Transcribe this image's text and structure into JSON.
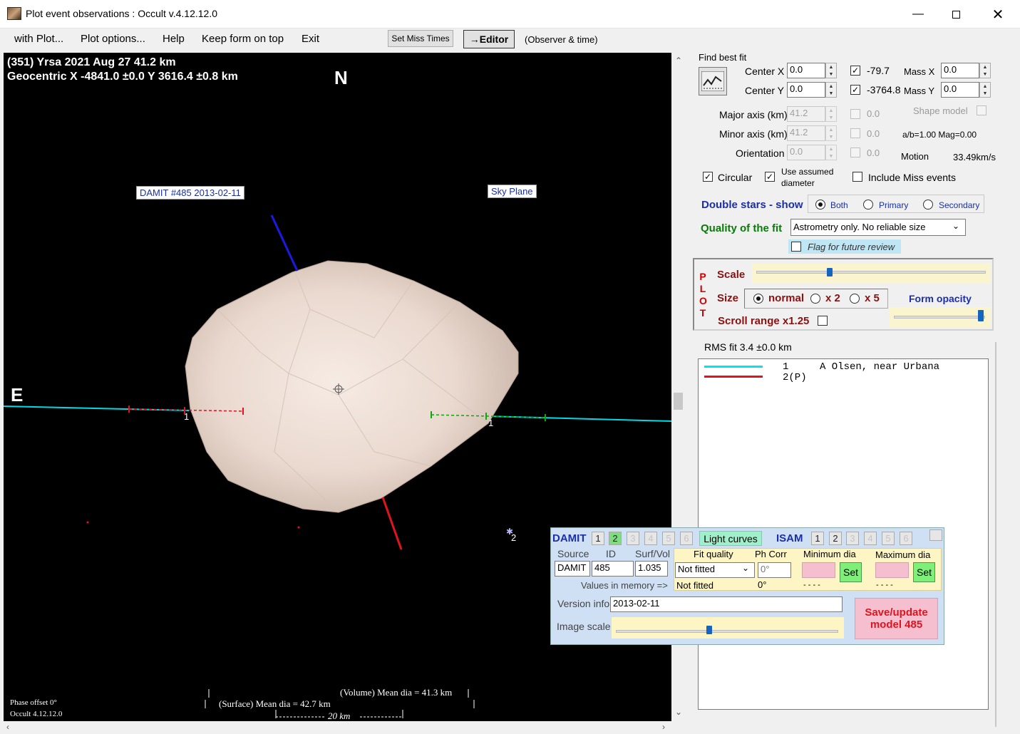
{
  "window": {
    "title": "Plot event observations : Occult v.4.12.12.0"
  },
  "menu": {
    "items": [
      "with Plot...",
      "Plot options...",
      "Help",
      "Keep form on top",
      "Exit"
    ],
    "set_miss_times": "Set Miss Times",
    "editor": "→Editor",
    "observer_time": "(Observer & time)"
  },
  "plot": {
    "header_line1": "(351) Yrsa  2021 Aug 27   41.2 km",
    "header_line2": "Geocentric  X  -4841.0 ±0.0  Y 3616.4 ±0.8 km",
    "north": "N",
    "east": "E",
    "damit_label": "DAMIT #485 2013-02-11",
    "sky_plane_label": "Sky Plane",
    "chord_label_1a": "1",
    "chord_label_1b": "1",
    "miss_label": "2",
    "volume_mean": "(Volume) Mean dia = 41.3 km",
    "surface_mean": "(Surface) Mean dia = 42.7 km",
    "scale_km": "20 km",
    "phase_offset": "Phase offset 0°",
    "version": "Occult 4.12.12.0"
  },
  "fit": {
    "find_best_fit": "Find best fit",
    "center_x_label": "Center X",
    "center_x": "0.0",
    "center_y_label": "Center Y",
    "center_y": "0.0",
    "center_x_value": "-79.7",
    "center_y_value": "-3764.8",
    "mass_x_label": "Mass X",
    "mass_x": "0.0",
    "mass_y_label": "Mass Y",
    "mass_y": "0.0",
    "major_label": "Major axis (km)",
    "major": "41.2",
    "major_chk": "0.0",
    "minor_label": "Minor axis (km)",
    "minor": "41.2",
    "minor_chk": "0.0",
    "orientation_label": "Orientation",
    "orientation": "0.0",
    "orientation_chk": "0.0",
    "shape_model": "Shape model",
    "ab_mag": "a/b=1.00  Mag=0.00",
    "motion_label": "Motion",
    "motion_value": "33.49km/s",
    "circular": "Circular",
    "use_assumed_1": "Use assumed",
    "use_assumed_2": "diameter",
    "include_miss": "Include Miss events"
  },
  "double_stars": {
    "label": "Double stars - show",
    "options": [
      "Both",
      "Primary",
      "Secondary"
    ],
    "selected": "Both"
  },
  "quality": {
    "label": "Quality of the fit",
    "value": "Astrometry only. No reliable size",
    "flag": "Flag for future review"
  },
  "plot_ctrl": {
    "letters": [
      "P",
      "L",
      "O",
      "T"
    ],
    "scale": "Scale",
    "size": "Size",
    "size_options": [
      "normal",
      "x 2",
      "x 5"
    ],
    "size_selected": "normal",
    "form_opacity": "Form opacity",
    "scroll_range": "Scroll range x1.25",
    "scale_level": 0.32,
    "opacity_level": 0.95
  },
  "rms": {
    "text": "RMS fit 3.4 ±0.0 km"
  },
  "legend": {
    "rows": [
      {
        "num": "1",
        "name": "A Olsen, near Urbana",
        "color": "#00e5ee"
      },
      {
        "num": "2(P)",
        "name": "",
        "color": "#e0141e"
      }
    ]
  },
  "damit": {
    "damit_label": "DAMIT",
    "damit_nums": [
      "1",
      "2",
      "3",
      "4",
      "5",
      "6"
    ],
    "damit_active": "2",
    "light_curves": "Light curves",
    "isam_label": "ISAM",
    "isam_nums": [
      "1",
      "2",
      "3",
      "4",
      "5",
      "6"
    ],
    "source_hdr": "Source",
    "id_hdr": "ID",
    "surf_hdr": "Surf/Vol",
    "source": "DAMIT",
    "id": "485",
    "surf_vol": "1.035",
    "fit_quality_hdr": "Fit quality",
    "ph_corr_hdr": "Ph Corr",
    "min_dia_hdr": "Minimum dia",
    "max_dia_hdr": "Maximum dia",
    "fit_quality": "Not fitted",
    "ph_corr": "0°",
    "set": "Set",
    "values_in_memory": "Values in memory =>",
    "mem_fit": "Not fitted",
    "mem_ph": "0°",
    "mem_min": "- - - -",
    "mem_max": "- - - -",
    "version_label": "Version info",
    "version": "2013-02-11",
    "image_scale": "Image scale",
    "image_scale_level": 0.42,
    "save_line1": "Save/update",
    "save_line2": "model 485"
  }
}
